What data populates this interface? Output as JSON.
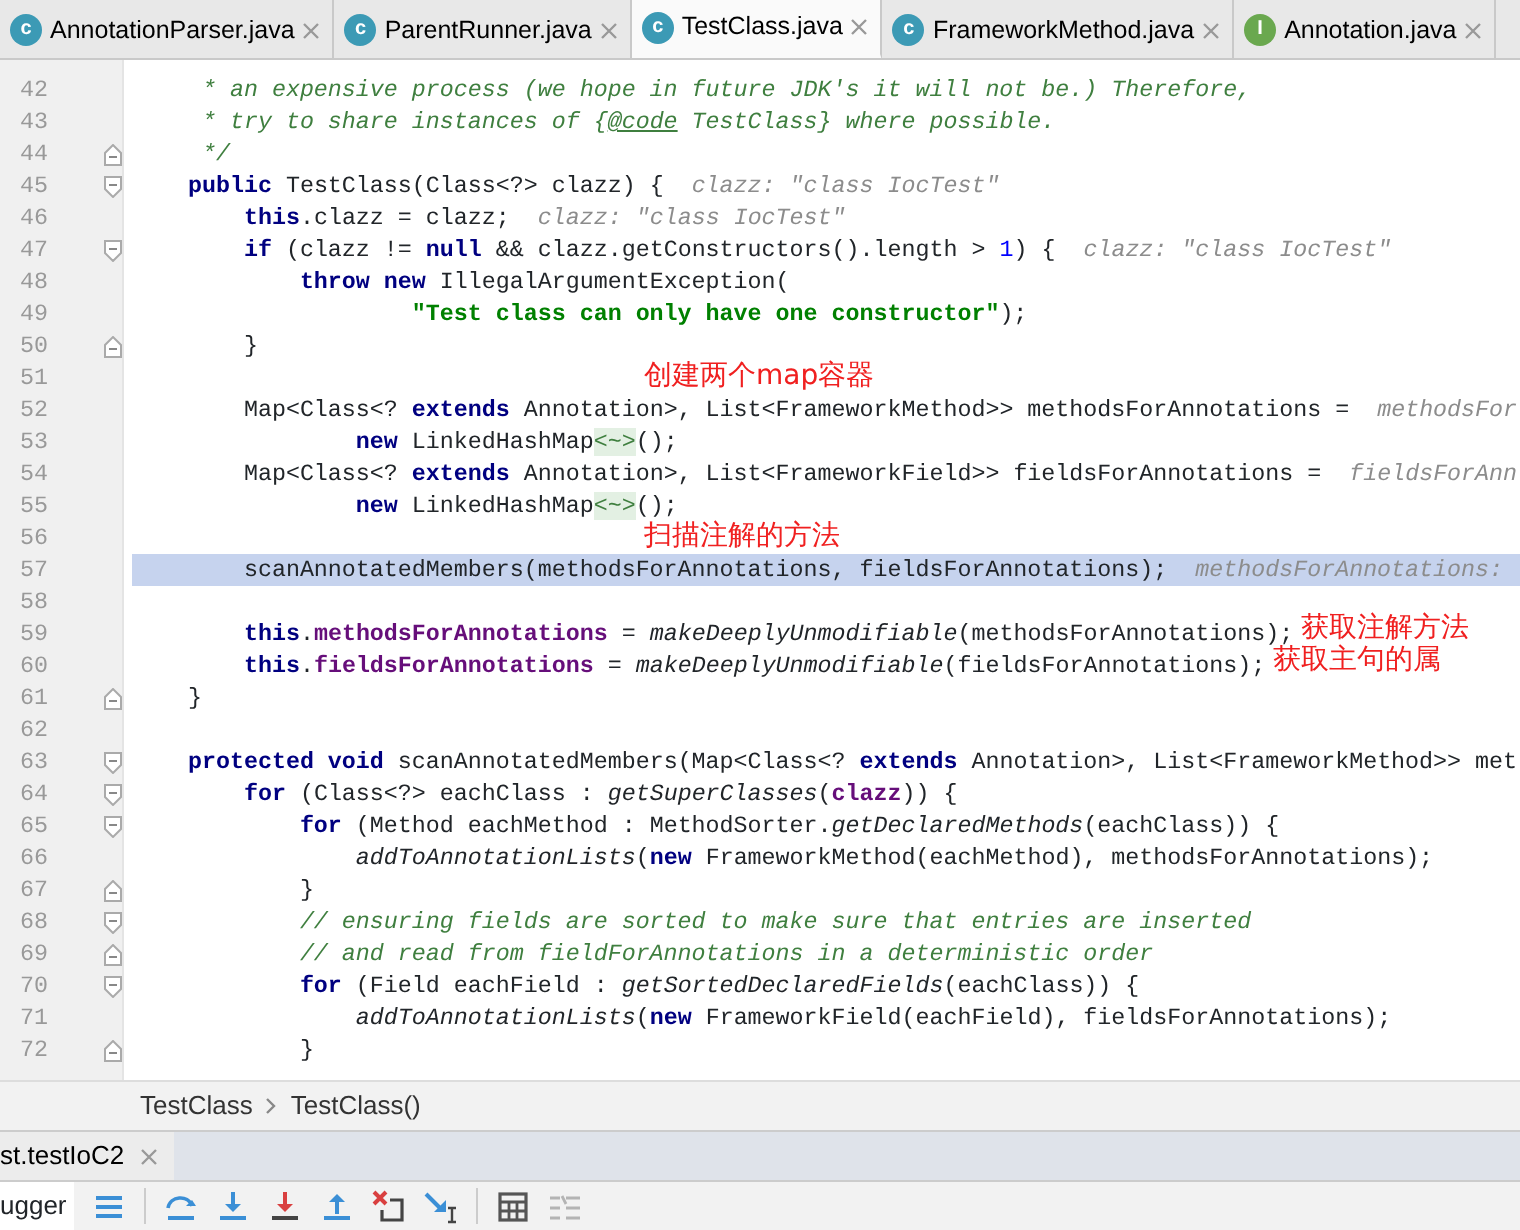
{
  "tabs": [
    {
      "label": "AnnotationParser.java",
      "kind": "class",
      "letter": "c",
      "selected": false
    },
    {
      "label": "ParentRunner.java",
      "kind": "class",
      "letter": "c",
      "selected": false
    },
    {
      "label": "TestClass.java",
      "kind": "class",
      "letter": "c",
      "selected": true
    },
    {
      "label": "FrameworkMethod.java",
      "kind": "class",
      "letter": "c",
      "selected": false
    },
    {
      "label": "Annotation.java",
      "kind": "interface",
      "letter": "I",
      "selected": false
    }
  ],
  "editor": {
    "lines": [
      {
        "number": "42",
        "current": false,
        "tokens": [
          {
            "kind": "doc",
            "text": "     * an expensive process (we hope in future JDK's it will not be.) Therefore,"
          }
        ]
      },
      {
        "number": "43",
        "current": false,
        "tokens": [
          {
            "kind": "doc",
            "text": "     * try to share instances of {"
          },
          {
            "kind": "doctag",
            "text": "@code"
          },
          {
            "kind": "doc",
            "text": " TestClass} where possible."
          }
        ]
      },
      {
        "number": "44",
        "current": false,
        "fold_marker": {
          "kind": "end"
        },
        "tokens": [
          {
            "kind": "doc",
            "text": "     */"
          }
        ]
      },
      {
        "number": "45",
        "current": false,
        "fold_marker": {
          "kind": "start"
        },
        "tokens": [
          {
            "kind": "kw",
            "text": "    public"
          },
          {
            "kind": "plain",
            "text": " TestClass(Class<?> clazz) {"
          }
        ],
        "hint": "clazz: \"class IocTest\""
      },
      {
        "number": "46",
        "current": false,
        "tokens": [
          {
            "kind": "kw",
            "text": "        this"
          },
          {
            "kind": "plain",
            "text": ".clazz = clazz;"
          }
        ],
        "hint": "clazz: \"class IocTest\""
      },
      {
        "number": "47",
        "current": false,
        "fold_marker": {
          "kind": "start"
        },
        "tokens": [
          {
            "kind": "kw",
            "text": "        if"
          },
          {
            "kind": "plain",
            "text": " (clazz != "
          },
          {
            "kind": "kw",
            "text": "null"
          },
          {
            "kind": "plain",
            "text": " && clazz.getConstructors().length > "
          },
          {
            "kind": "num",
            "text": "1"
          },
          {
            "kind": "plain",
            "text": ") {"
          }
        ],
        "hint": "clazz: \"class IocTest\""
      },
      {
        "number": "48",
        "current": false,
        "tokens": [
          {
            "kind": "kw",
            "text": "            throw new"
          },
          {
            "kind": "plain",
            "text": " IllegalArgumentException("
          }
        ]
      },
      {
        "number": "49",
        "current": false,
        "tokens": [
          {
            "kind": "str",
            "text": "                    \"Test class can only have one constructor\""
          },
          {
            "kind": "plain",
            "text": ");"
          }
        ]
      },
      {
        "number": "50",
        "current": false,
        "fold_marker": {
          "kind": "end"
        },
        "tokens": [
          {
            "kind": "plain",
            "text": "        }"
          }
        ]
      },
      {
        "number": "51",
        "current": false,
        "note": "创建两个map容器"
      },
      {
        "number": "52",
        "current": false,
        "tokens": [
          {
            "kind": "plain",
            "text": "        Map<Class<? "
          },
          {
            "kind": "kw",
            "text": "extends"
          },
          {
            "kind": "plain",
            "text": " Annotation>, List<FrameworkMethod>> methodsForAnnotations ="
          }
        ],
        "hint": "methodsFor"
      },
      {
        "number": "53",
        "current": false,
        "tokens": [
          {
            "kind": "kw",
            "text": "                new"
          },
          {
            "kind": "plain",
            "text": " LinkedHashMap"
          },
          {
            "kind": "folded",
            "text": "<~>"
          },
          {
            "kind": "plain",
            "text": "();"
          }
        ]
      },
      {
        "number": "54",
        "current": false,
        "tokens": [
          {
            "kind": "plain",
            "text": "        Map<Class<? "
          },
          {
            "kind": "kw",
            "text": "extends"
          },
          {
            "kind": "plain",
            "text": " Annotation>, List<FrameworkField>> fieldsForAnnotations ="
          }
        ],
        "hint": "fieldsForAnn"
      },
      {
        "number": "55",
        "current": false,
        "tokens": [
          {
            "kind": "kw",
            "text": "                new"
          },
          {
            "kind": "plain",
            "text": " LinkedHashMap"
          },
          {
            "kind": "folded",
            "text": "<~>"
          },
          {
            "kind": "plain",
            "text": "();"
          }
        ]
      },
      {
        "number": "56",
        "current": false,
        "note": "扫描注解的方法"
      },
      {
        "number": "57",
        "current": true,
        "tokens": [
          {
            "kind": "plain",
            "text": "        scanAnnotatedMembers(methodsForAnnotations, fieldsForAnnotations);"
          }
        ],
        "hint": "methodsForAnnotations:"
      },
      {
        "number": "58",
        "current": false
      },
      {
        "number": "59",
        "current": false,
        "tokens": [
          {
            "kind": "kw",
            "text": "        this"
          },
          {
            "kind": "plain",
            "text": "."
          },
          {
            "kind": "field",
            "text": "methodsForAnnotations"
          },
          {
            "kind": "plain",
            "text": " = "
          },
          {
            "kind": "call",
            "text": "makeDeeplyUnmodifiable"
          },
          {
            "kind": "plain",
            "text": "(methodsForAnnotations);"
          }
        ],
        "note": "获取注解方法"
      },
      {
        "number": "60",
        "current": false,
        "tokens": [
          {
            "kind": "kw",
            "text": "        this"
          },
          {
            "kind": "plain",
            "text": "."
          },
          {
            "kind": "field",
            "text": "fieldsForAnnotations"
          },
          {
            "kind": "plain",
            "text": " = "
          },
          {
            "kind": "call",
            "text": "makeDeeplyUnmodifiable"
          },
          {
            "kind": "plain",
            "text": "(fieldsForAnnotations);"
          }
        ],
        "note": "获取主句的属"
      },
      {
        "number": "61",
        "current": false,
        "fold_marker": {
          "kind": "end"
        },
        "tokens": [
          {
            "kind": "plain",
            "text": "    }"
          }
        ]
      },
      {
        "number": "62",
        "current": false
      },
      {
        "number": "63",
        "current": false,
        "fold_marker": {
          "kind": "start"
        },
        "tokens": [
          {
            "kind": "kw",
            "text": "    protected void"
          },
          {
            "kind": "plain",
            "text": " scanAnnotatedMembers(Map<Class<? "
          },
          {
            "kind": "kw",
            "text": "extends"
          },
          {
            "kind": "plain",
            "text": " Annotation>, List<FrameworkMethod>> met"
          }
        ]
      },
      {
        "number": "64",
        "current": false,
        "fold_marker": {
          "kind": "start"
        },
        "tokens": [
          {
            "kind": "kw",
            "text": "        for"
          },
          {
            "kind": "plain",
            "text": " (Class<?> eachClass : "
          },
          {
            "kind": "call",
            "text": "getSuperClasses"
          },
          {
            "kind": "plain",
            "text": "("
          },
          {
            "kind": "field",
            "text": "clazz"
          },
          {
            "kind": "plain",
            "text": ")) {"
          }
        ]
      },
      {
        "number": "65",
        "current": false,
        "fold_marker": {
          "kind": "start"
        },
        "tokens": [
          {
            "kind": "kw",
            "text": "            for"
          },
          {
            "kind": "plain",
            "text": " (Method eachMethod : MethodSorter."
          },
          {
            "kind": "call",
            "text": "getDeclaredMethods"
          },
          {
            "kind": "plain",
            "text": "(eachClass)) {"
          }
        ]
      },
      {
        "number": "66",
        "current": false,
        "tokens": [
          {
            "kind": "call",
            "text": "                addToAnnotationLists"
          },
          {
            "kind": "plain",
            "text": "("
          },
          {
            "kind": "kw",
            "text": "new"
          },
          {
            "kind": "plain",
            "text": " FrameworkMethod(eachMethod), methodsForAnnotations);"
          }
        ]
      },
      {
        "number": "67",
        "current": false,
        "fold_marker": {
          "kind": "end"
        },
        "tokens": [
          {
            "kind": "plain",
            "text": "            }"
          }
        ]
      },
      {
        "number": "68",
        "current": false,
        "fold_marker": {
          "kind": "start"
        },
        "tokens": [
          {
            "kind": "comment",
            "text": "            // ensuring fields are sorted to make sure that entries are inserted"
          }
        ]
      },
      {
        "number": "69",
        "current": false,
        "fold_marker": {
          "kind": "end"
        },
        "tokens": [
          {
            "kind": "comment",
            "text": "            // and read from fieldForAnnotations in a deterministic order"
          }
        ]
      },
      {
        "number": "70",
        "current": false,
        "fold_marker": {
          "kind": "start"
        },
        "tokens": [
          {
            "kind": "kw",
            "text": "            for"
          },
          {
            "kind": "plain",
            "text": " (Field eachField : "
          },
          {
            "kind": "call",
            "text": "getSortedDeclaredFields"
          },
          {
            "kind": "plain",
            "text": "(eachClass)) {"
          }
        ]
      },
      {
        "number": "71",
        "current": false,
        "tokens": [
          {
            "kind": "call",
            "text": "                addToAnnotationLists"
          },
          {
            "kind": "plain",
            "text": "("
          },
          {
            "kind": "kw",
            "text": "new"
          },
          {
            "kind": "plain",
            "text": " FrameworkField(eachField), fieldsForAnnotations);"
          }
        ]
      },
      {
        "number": "72",
        "current": false,
        "fold_marker": {
          "kind": "end"
        },
        "tokens": [
          {
            "kind": "plain",
            "text": "            }"
          }
        ]
      }
    ]
  },
  "breadcrumb": [
    "TestClass",
    "TestClass()"
  ],
  "debug_tab": {
    "label": "st.testIoC2"
  },
  "toolbar": {
    "label": "ugger",
    "buttons": [
      {
        "kind": "threads",
        "disabled": false
      },
      {
        "kind": "step_over",
        "disabled": false
      },
      {
        "kind": "step_into",
        "disabled": false
      },
      {
        "kind": "force_step_into",
        "disabled": false
      },
      {
        "kind": "step_out",
        "disabled": false
      },
      {
        "kind": "drop_frame",
        "disabled": false
      },
      {
        "kind": "run_to_cursor",
        "disabled": false
      },
      {
        "kind": "evaluate",
        "disabled": false
      },
      {
        "kind": "trace",
        "disabled": true
      }
    ]
  }
}
